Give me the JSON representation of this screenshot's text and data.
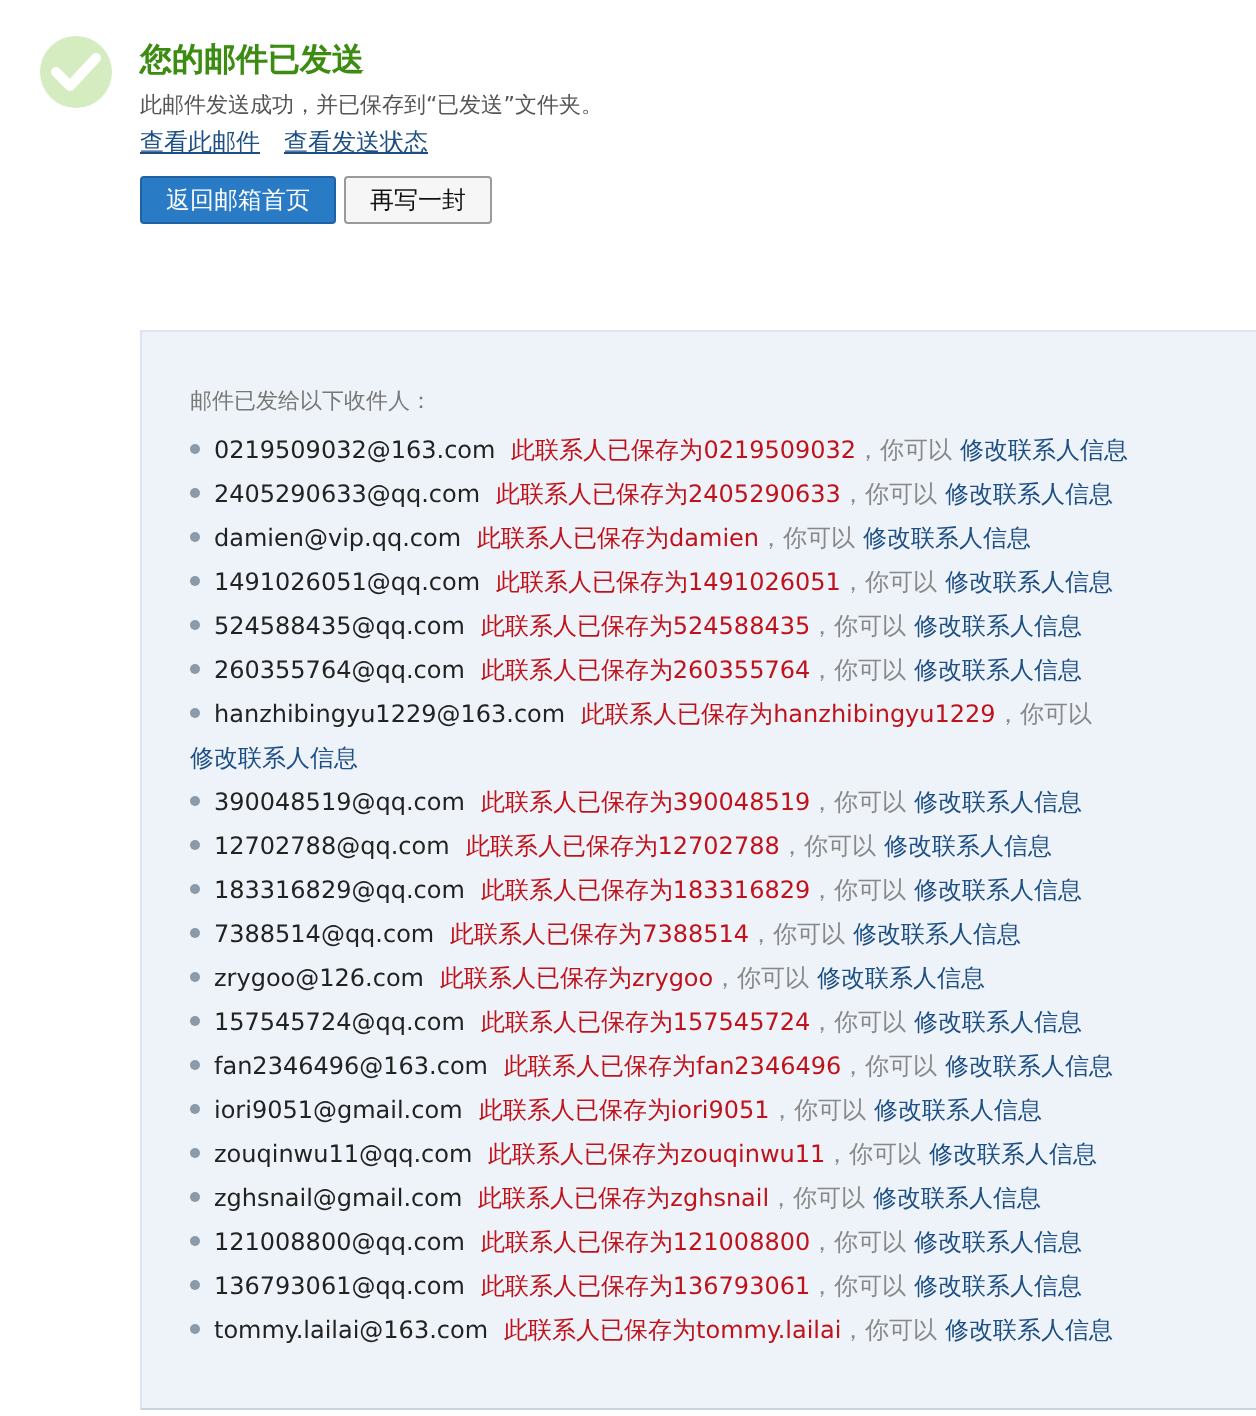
{
  "header": {
    "title": "您的邮件已发送",
    "message": "此邮件发送成功，并已保存到“已发送”文件夹。",
    "links": [
      "查看此邮件",
      "查看发送状态"
    ]
  },
  "buttons": [
    {
      "label": "返回邮箱首页",
      "kind": "primary"
    },
    {
      "label": "再写一封",
      "kind": "secondary"
    }
  ],
  "recipients": {
    "heading": "邮件已发给以下收件人：",
    "items": [
      {
        "email": "0219509032@163.com",
        "saved": "此联系人已保存为0219509032",
        "note": "，你可以",
        "link": "修改联系人信息"
      },
      {
        "email": "2405290633@qq.com",
        "saved": "此联系人已保存为2405290633",
        "note": "，你可以",
        "link": "修改联系人信息"
      },
      {
        "email": "damien@vip.qq.com",
        "saved": "此联系人已保存为damien",
        "note": "，你可以",
        "link": "修改联系人信息"
      },
      {
        "email": "1491026051@qq.com",
        "saved": "此联系人已保存为1491026051",
        "note": "，你可以",
        "link": "修改联系人信息"
      },
      {
        "email": "524588435@qq.com",
        "saved": "此联系人已保存为524588435",
        "note": "，你可以",
        "link": "修改联系人信息"
      },
      {
        "email": "260355764@qq.com",
        "saved": "此联系人已保存为260355764",
        "note": "，你可以",
        "link": "修改联系人信息"
      },
      {
        "email": "hanzhibingyu1229@163.com",
        "saved": "此联系人已保存为hanzhibingyu1229",
        "note": "，你可以",
        "link": "修改联系人信息"
      },
      {
        "email": "390048519@qq.com",
        "saved": "此联系人已保存为390048519",
        "note": "，你可以",
        "link": "修改联系人信息"
      },
      {
        "email": "12702788@qq.com",
        "saved": "此联系人已保存为12702788",
        "note": "，你可以",
        "link": "修改联系人信息"
      },
      {
        "email": "183316829@qq.com",
        "saved": "此联系人已保存为183316829",
        "note": "，你可以",
        "link": "修改联系人信息"
      },
      {
        "email": "7388514@qq.com",
        "saved": "此联系人已保存为7388514",
        "note": "，你可以",
        "link": "修改联系人信息"
      },
      {
        "email": "zrygoo@126.com",
        "saved": "此联系人已保存为zrygoo",
        "note": "，你可以",
        "link": "修改联系人信息"
      },
      {
        "email": "157545724@qq.com",
        "saved": "此联系人已保存为157545724",
        "note": "，你可以",
        "link": "修改联系人信息"
      },
      {
        "email": "fan2346496@163.com",
        "saved": "此联系人已保存为fan2346496",
        "note": "，你可以",
        "link": "修改联系人信息"
      },
      {
        "email": "iori9051@gmail.com",
        "saved": "此联系人已保存为iori9051",
        "note": "，你可以",
        "link": "修改联系人信息"
      },
      {
        "email": "zouqinwu11@qq.com",
        "saved": "此联系人已保存为zouqinwu11",
        "note": "，你可以",
        "link": "修改联系人信息"
      },
      {
        "email": "zghsnail@gmail.com",
        "saved": "此联系人已保存为zghsnail",
        "note": "，你可以",
        "link": "修改联系人信息"
      },
      {
        "email": "121008800@qq.com",
        "saved": "此联系人已保存为121008800",
        "note": "，你可以",
        "link": "修改联系人信息"
      },
      {
        "email": "136793061@qq.com",
        "saved": "此联系人已保存为136793061",
        "note": "，你可以",
        "link": "修改联系人信息"
      },
      {
        "email": "tommy.lailai@163.com",
        "saved": "此联系人已保存为tommy.lailai",
        "note": "，你可以",
        "link": "修改联系人信息"
      }
    ]
  }
}
